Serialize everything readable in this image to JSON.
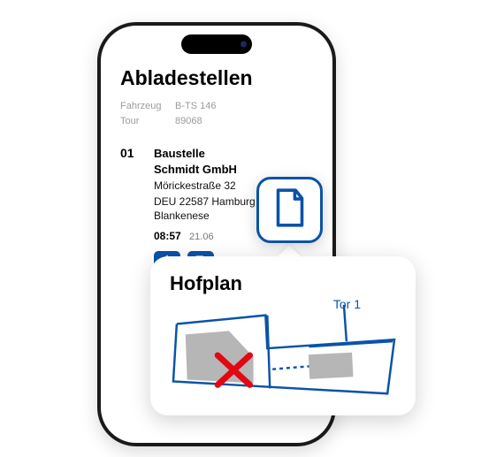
{
  "colors": {
    "accent": "#0a53a8",
    "danger": "#e30613"
  },
  "header": {
    "title": "Abladestellen",
    "meta": {
      "vehicle_label": "Fahrzeug",
      "vehicle_value": "B-TS 146",
      "tour_label": "Tour",
      "tour_value": "89068"
    }
  },
  "stops": [
    {
      "index": "01",
      "name_line1": "Baustelle",
      "name_line2": "Schmidt GmbH",
      "street": "Mörickestraße 32",
      "city": "DEU 22587 Hamburg / Blankenese",
      "time": "08:57",
      "date": "21.06",
      "actions": {
        "navigate_icon_name": "navigate-icon",
        "attach_icon_name": "attach-doc-icon"
      }
    }
  ],
  "doc_chip": {
    "icon_name": "document-icon"
  },
  "callout": {
    "title": "Hofplan",
    "gate_label": "Tor 1"
  }
}
